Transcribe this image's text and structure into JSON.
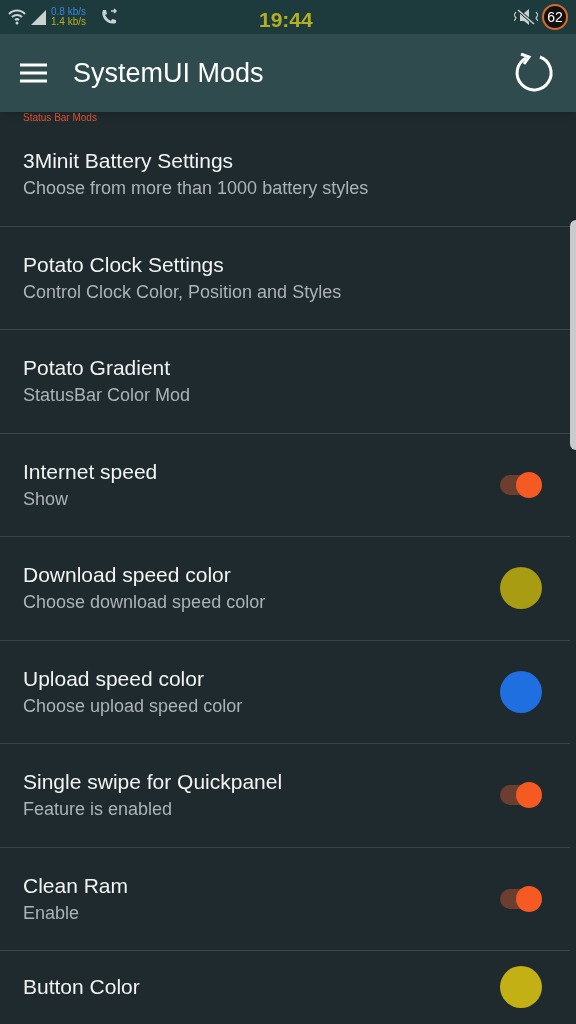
{
  "status_bar": {
    "download_speed": "0.8 kb/s",
    "upload_speed": "1.4 kb/s",
    "time": "19:44",
    "battery": "62"
  },
  "app_bar": {
    "title": "SystemUI Mods"
  },
  "section_header": "Status Bar Mods",
  "settings": [
    {
      "kind": "nav",
      "title": "3Minit Battery Settings",
      "subtitle": "Choose from more than 1000 battery styles"
    },
    {
      "kind": "nav",
      "title": "Potato Clock Settings",
      "subtitle": "Control Clock Color, Position and Styles"
    },
    {
      "kind": "nav",
      "title": "Potato Gradient",
      "subtitle": "StatusBar Color Mod"
    },
    {
      "kind": "toggle",
      "title": "Internet speed",
      "subtitle": "Show",
      "on": true
    },
    {
      "kind": "color",
      "title": "Download speed color",
      "subtitle": "Choose download speed color",
      "color": "#a89c12"
    },
    {
      "kind": "color",
      "title": "Upload speed color",
      "subtitle": "Choose upload speed color",
      "color": "#1f6fe0"
    },
    {
      "kind": "toggle",
      "title": "Single swipe for Quickpanel",
      "subtitle": "Feature is enabled",
      "on": true
    },
    {
      "kind": "toggle",
      "title": "Clean Ram",
      "subtitle": "Enable",
      "on": true
    },
    {
      "kind": "color",
      "title": "Button Color",
      "color": "#c2b015"
    }
  ]
}
